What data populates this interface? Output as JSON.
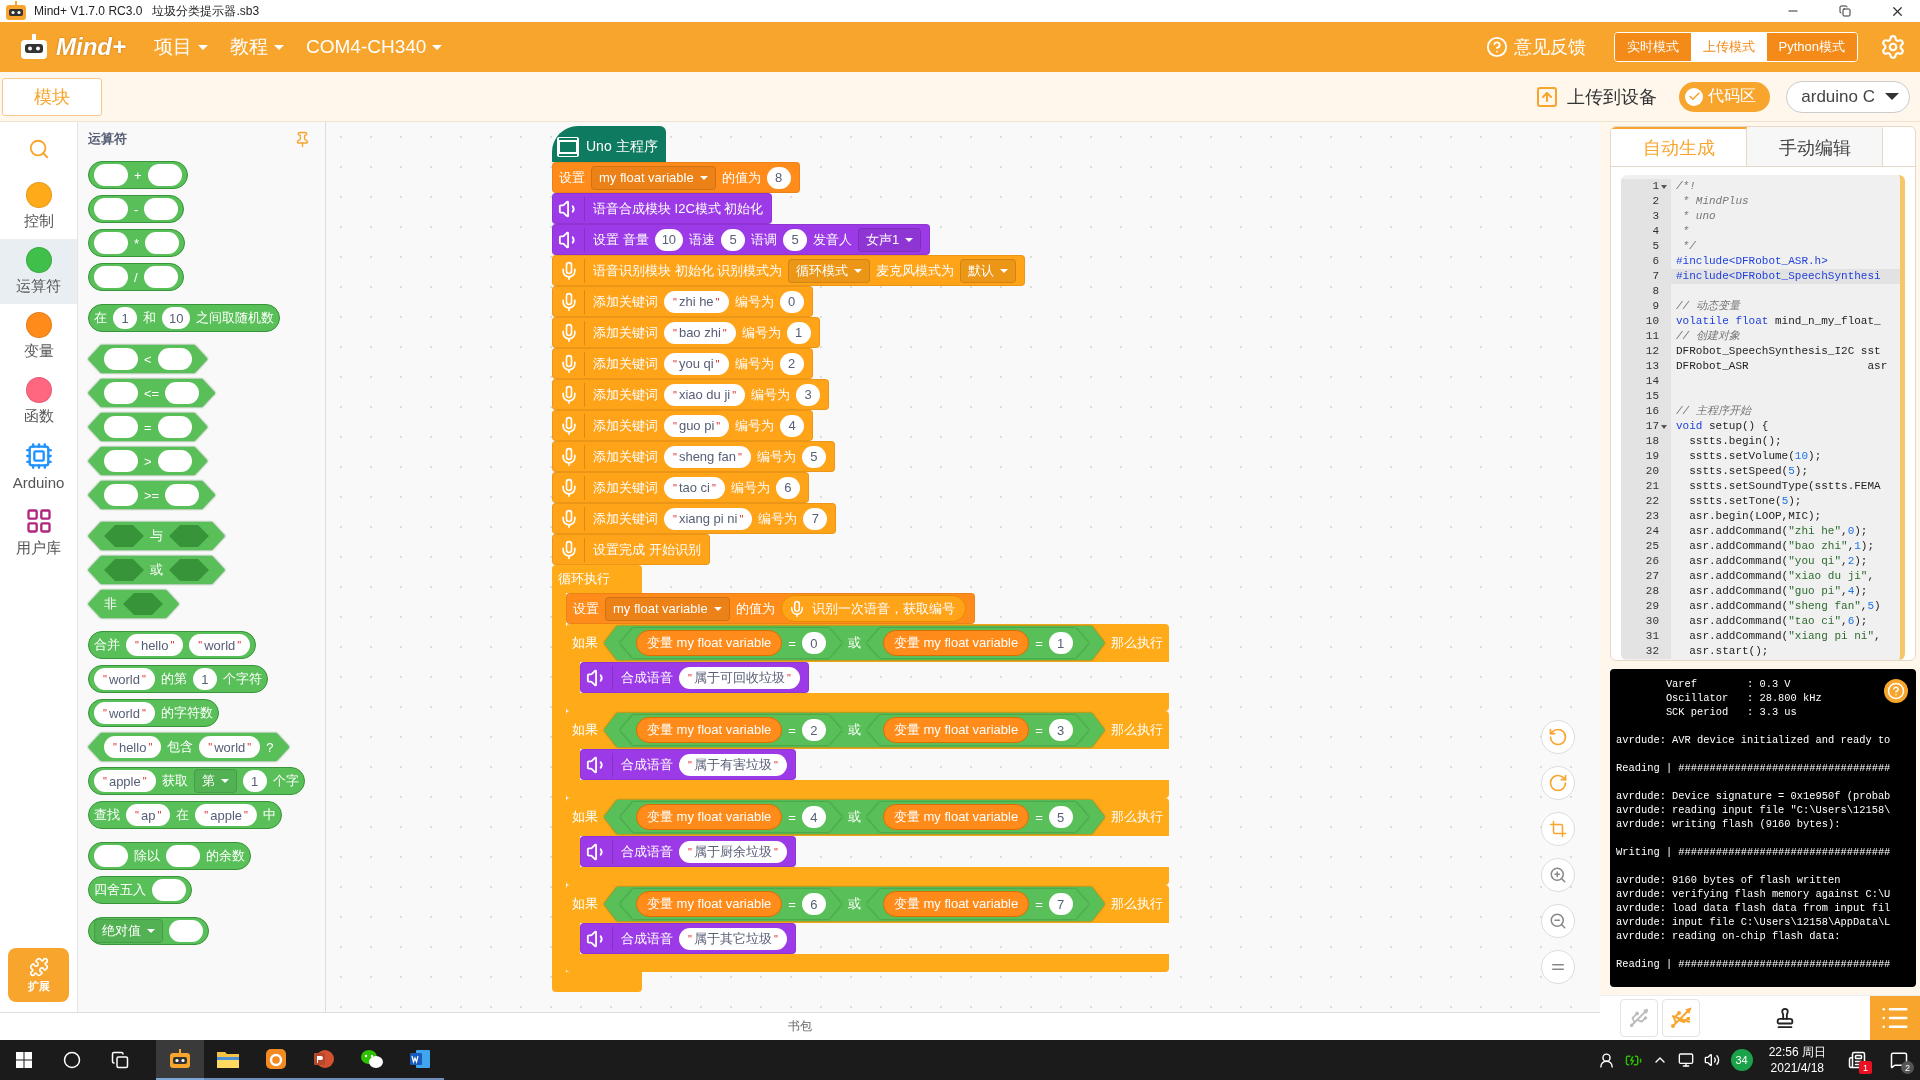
{
  "window": {
    "title": "Mind+ V1.7.0 RC3.0   垃圾分类提示器.sb3"
  },
  "menubar": {
    "logo": "Mind+",
    "menus": [
      {
        "label": "项目"
      },
      {
        "label": "教程"
      },
      {
        "label": "COM4-CH340"
      }
    ],
    "feedback": "意见反馈",
    "modes": [
      {
        "label": "实时模式",
        "selected": false
      },
      {
        "label": "上传模式",
        "selected": true
      },
      {
        "label": "Python模式",
        "selected": false
      }
    ]
  },
  "toolbar": {
    "tab": "模块",
    "upload": "上传到设备",
    "code_toggle": {
      "label": "代码区",
      "on": true
    },
    "language": "arduino C"
  },
  "categories": [
    {
      "kind": "dot",
      "label": "控制",
      "color": "#ffab19",
      "selected": false
    },
    {
      "kind": "dot",
      "label": "运算符",
      "color": "#40bf4a",
      "selected": true
    },
    {
      "kind": "dot",
      "label": "变量",
      "color": "#ff8c1a",
      "selected": false
    },
    {
      "kind": "dot",
      "label": "函数",
      "color": "#ff6680",
      "selected": false
    },
    {
      "kind": "chip",
      "label": "Arduino",
      "selected": false
    },
    {
      "kind": "library",
      "label": "用户库",
      "selected": false
    }
  ],
  "extension": "扩展",
  "palette": {
    "title": "运算符",
    "groups": [
      [
        {
          "kind": "reporter",
          "parts": [
            {
              "kind": "slot"
            },
            {
              "kind": "text",
              "text": "+"
            },
            {
              "kind": "slot"
            }
          ]
        },
        {
          "kind": "reporter",
          "parts": [
            {
              "kind": "slot"
            },
            {
              "kind": "text",
              "text": "-"
            },
            {
              "kind": "slot"
            }
          ]
        },
        {
          "kind": "reporter",
          "parts": [
            {
              "kind": "slot"
            },
            {
              "kind": "text",
              "text": "*"
            },
            {
              "kind": "slot"
            }
          ]
        },
        {
          "kind": "reporter",
          "parts": [
            {
              "kind": "slot"
            },
            {
              "kind": "text",
              "text": "/"
            },
            {
              "kind": "slot"
            }
          ]
        }
      ],
      [
        {
          "kind": "reporter",
          "parts": [
            {
              "kind": "text",
              "text": "在"
            },
            {
              "kind": "number",
              "text": "1"
            },
            {
              "kind": "text",
              "text": "和"
            },
            {
              "kind": "number",
              "text": "10"
            },
            {
              "kind": "text",
              "text": "之间取随机数"
            }
          ]
        }
      ],
      [
        {
          "kind": "boolean",
          "parts": [
            {
              "kind": "slot"
            },
            {
              "kind": "text",
              "text": "<"
            },
            {
              "kind": "slot"
            }
          ]
        },
        {
          "kind": "boolean",
          "parts": [
            {
              "kind": "slot"
            },
            {
              "kind": "text",
              "text": "<="
            },
            {
              "kind": "slot"
            }
          ]
        },
        {
          "kind": "boolean",
          "parts": [
            {
              "kind": "slot"
            },
            {
              "kind": "text",
              "text": "="
            },
            {
              "kind": "slot"
            }
          ]
        },
        {
          "kind": "boolean",
          "parts": [
            {
              "kind": "slot"
            },
            {
              "kind": "text",
              "text": ">"
            },
            {
              "kind": "slot"
            }
          ]
        },
        {
          "kind": "boolean",
          "parts": [
            {
              "kind": "slot"
            },
            {
              "kind": "text",
              "text": ">="
            },
            {
              "kind": "slot"
            }
          ]
        }
      ],
      [
        {
          "kind": "boolean",
          "parts": [
            {
              "kind": "bool-slot"
            },
            {
              "kind": "text",
              "text": "与"
            },
            {
              "kind": "bool-slot"
            }
          ]
        },
        {
          "kind": "boolean",
          "parts": [
            {
              "kind": "bool-slot"
            },
            {
              "kind": "text",
              "text": "或"
            },
            {
              "kind": "bool-slot"
            }
          ]
        },
        {
          "kind": "boolean",
          "parts": [
            {
              "kind": "text",
              "text": "非"
            },
            {
              "kind": "bool-slot"
            }
          ]
        }
      ],
      [
        {
          "kind": "reporter",
          "parts": [
            {
              "kind": "text",
              "text": "合并"
            },
            {
              "kind": "string",
              "quote": "\"",
              "text": "hello"
            },
            {
              "kind": "string",
              "quote": "\"",
              "text": "world"
            }
          ]
        },
        {
          "kind": "reporter",
          "parts": [
            {
              "kind": "string",
              "quote": "\"",
              "text": "world"
            },
            {
              "kind": "text",
              "text": "的第"
            },
            {
              "kind": "number",
              "text": "1"
            },
            {
              "kind": "text",
              "text": "个字符"
            }
          ]
        },
        {
          "kind": "reporter",
          "parts": [
            {
              "kind": "string",
              "quote": "\"",
              "text": "world"
            },
            {
              "kind": "text",
              "text": "的字符数"
            }
          ]
        },
        {
          "kind": "boolean",
          "parts": [
            {
              "kind": "string",
              "quote": "\"",
              "text": "hello"
            },
            {
              "kind": "text",
              "text": "包含"
            },
            {
              "kind": "string",
              "quote": "\"",
              "text": "world"
            },
            {
              "kind": "text",
              "text": "?"
            }
          ]
        },
        {
          "kind": "reporter",
          "parts": [
            {
              "kind": "string",
              "quote": "\"",
              "text": "apple"
            },
            {
              "kind": "text",
              "text": "获取"
            },
            {
              "kind": "dropdown",
              "text": "第"
            },
            {
              "kind": "number",
              "text": "1"
            },
            {
              "kind": "text",
              "text": "个字"
            }
          ]
        },
        {
          "kind": "reporter",
          "parts": [
            {
              "kind": "text",
              "text": "查找"
            },
            {
              "kind": "string",
              "quote": "\"",
              "text": "ap"
            },
            {
              "kind": "text",
              "text": "在"
            },
            {
              "kind": "string",
              "quote": "\"",
              "text": "apple"
            },
            {
              "kind": "text",
              "text": "中"
            }
          ]
        }
      ],
      [
        {
          "kind": "reporter",
          "parts": [
            {
              "kind": "slot"
            },
            {
              "kind": "text",
              "text": "除以"
            },
            {
              "kind": "slot"
            },
            {
              "kind": "text",
              "text": "的余数"
            }
          ]
        },
        {
          "kind": "reporter",
          "parts": [
            {
              "kind": "text",
              "text": "四舍五入"
            },
            {
              "kind": "slot"
            }
          ]
        }
      ],
      [
        {
          "kind": "reporter",
          "parts": [
            {
              "kind": "dropdown",
              "text": "绝对值"
            },
            {
              "kind": "slot"
            }
          ]
        }
      ]
    ]
  },
  "workspace": {
    "hat": "Uno 主程序",
    "blocks": [
      {
        "kind": "set",
        "parts": [
          {
            "kind": "text",
            "text": "设置"
          },
          {
            "kind": "dropdown",
            "text": "my float variable"
          },
          {
            "kind": "text",
            "text": "的值为"
          },
          {
            "kind": "number",
            "text": "8"
          }
        ]
      },
      {
        "kind": "speech",
        "parts": [
          {
            "kind": "text",
            "text": "语音合成模块 I2C模式 初始化"
          }
        ]
      },
      {
        "kind": "speech",
        "parts": [
          {
            "kind": "text",
            "text": "设置 音量"
          },
          {
            "kind": "number",
            "text": "10"
          },
          {
            "kind": "text",
            "text": "语速"
          },
          {
            "kind": "number",
            "text": "5"
          },
          {
            "kind": "text",
            "text": "语调"
          },
          {
            "kind": "number",
            "text": "5"
          },
          {
            "kind": "text",
            "text": "发音人"
          },
          {
            "kind": "dropdown",
            "text": "女声1"
          }
        ]
      },
      {
        "kind": "asr",
        "parts": [
          {
            "kind": "text",
            "text": "语音识别模块 初始化 识别模式为"
          },
          {
            "kind": "dropdown",
            "text": "循环模式"
          },
          {
            "kind": "text",
            "text": "麦克风模式为"
          },
          {
            "kind": "dropdown",
            "text": "默认"
          }
        ]
      },
      {
        "kind": "asr",
        "parts": [
          {
            "kind": "text",
            "text": "添加关键词"
          },
          {
            "kind": "string",
            "quote": "\"",
            "text": "zhi he"
          },
          {
            "kind": "text",
            "text": "编号为"
          },
          {
            "kind": "number",
            "text": "0"
          }
        ]
      },
      {
        "kind": "asr",
        "parts": [
          {
            "kind": "text",
            "text": "添加关键词"
          },
          {
            "kind": "string",
            "quote": "\"",
            "text": "bao zhi"
          },
          {
            "kind": "text",
            "text": "编号为"
          },
          {
            "kind": "number",
            "text": "1"
          }
        ]
      },
      {
        "kind": "asr",
        "parts": [
          {
            "kind": "text",
            "text": "添加关键词"
          },
          {
            "kind": "string",
            "quote": "\"",
            "text": "you qi"
          },
          {
            "kind": "text",
            "text": "编号为"
          },
          {
            "kind": "number",
            "text": "2"
          }
        ]
      },
      {
        "kind": "asr",
        "parts": [
          {
            "kind": "text",
            "text": "添加关键词"
          },
          {
            "kind": "string",
            "quote": "\"",
            "text": "xiao du ji"
          },
          {
            "kind": "text",
            "text": "编号为"
          },
          {
            "kind": "number",
            "text": "3"
          }
        ]
      },
      {
        "kind": "asr",
        "parts": [
          {
            "kind": "text",
            "text": "添加关键词"
          },
          {
            "kind": "string",
            "quote": "\"",
            "text": "guo pi"
          },
          {
            "kind": "text",
            "text": "编号为"
          },
          {
            "kind": "number",
            "text": "4"
          }
        ]
      },
      {
        "kind": "asr",
        "parts": [
          {
            "kind": "text",
            "text": "添加关键词"
          },
          {
            "kind": "string",
            "quote": "\"",
            "text": "sheng fan"
          },
          {
            "kind": "text",
            "text": "编号为"
          },
          {
            "kind": "number",
            "text": "5"
          }
        ]
      },
      {
        "kind": "asr",
        "parts": [
          {
            "kind": "text",
            "text": "添加关键词"
          },
          {
            "kind": "string",
            "quote": "\"",
            "text": "tao ci"
          },
          {
            "kind": "text",
            "text": "编号为"
          },
          {
            "kind": "number",
            "text": "6"
          }
        ]
      },
      {
        "kind": "asr",
        "parts": [
          {
            "kind": "text",
            "text": "添加关键词"
          },
          {
            "kind": "string",
            "quote": "\"",
            "text": "xiang pi ni"
          },
          {
            "kind": "text",
            "text": "编号为"
          },
          {
            "kind": "number",
            "text": "7"
          }
        ]
      },
      {
        "kind": "asr",
        "parts": [
          {
            "kind": "text",
            "text": "设置完成 开始识别"
          }
        ]
      },
      {
        "kind": "loop",
        "parts": [
          {
            "kind": "text",
            "text": "循环执行"
          }
        ],
        "children": [
          {
            "kind": "set",
            "parts": [
              {
                "kind": "text",
                "text": "设置"
              },
              {
                "kind": "dropdown",
                "text": "my float variable"
              },
              {
                "kind": "text",
                "text": "的值为"
              },
              {
                "kind": "asr-reporter",
                "text": "识别一次语音，获取编号"
              }
            ]
          },
          {
            "kind": "if",
            "parts": [
              {
                "kind": "text",
                "text": "如果"
              },
              {
                "kind": "boolean",
                "parts": [
                  {
                    "kind": "boolean",
                    "parts": [
                      {
                        "kind": "variable",
                        "text": "变量 my float variable"
                      },
                      {
                        "kind": "text",
                        "text": "="
                      },
                      {
                        "kind": "number",
                        "text": "0"
                      }
                    ]
                  },
                  {
                    "kind": "text",
                    "text": "或"
                  },
                  {
                    "kind": "boolean",
                    "parts": [
                      {
                        "kind": "variable",
                        "text": "变量 my float variable"
                      },
                      {
                        "kind": "text",
                        "text": "="
                      },
                      {
                        "kind": "number",
                        "text": "1"
                      }
                    ]
                  }
                ]
              },
              {
                "kind": "text",
                "text": "那么执行"
              }
            ],
            "children": [
              {
                "kind": "speech",
                "parts": [
                  {
                    "kind": "text",
                    "text": "合成语音"
                  },
                  {
                    "kind": "string",
                    "quote": "\"",
                    "text": "属于可回收垃圾"
                  }
                ]
              }
            ]
          },
          {
            "kind": "if",
            "parts": [
              {
                "kind": "text",
                "text": "如果"
              },
              {
                "kind": "boolean",
                "parts": [
                  {
                    "kind": "boolean",
                    "parts": [
                      {
                        "kind": "variable",
                        "text": "变量 my float variable"
                      },
                      {
                        "kind": "text",
                        "text": "="
                      },
                      {
                        "kind": "number",
                        "text": "2"
                      }
                    ]
                  },
                  {
                    "kind": "text",
                    "text": "或"
                  },
                  {
                    "kind": "boolean",
                    "parts": [
                      {
                        "kind": "variable",
                        "text": "变量 my float variable"
                      },
                      {
                        "kind": "text",
                        "text": "="
                      },
                      {
                        "kind": "number",
                        "text": "3"
                      }
                    ]
                  }
                ]
              },
              {
                "kind": "text",
                "text": "那么执行"
              }
            ],
            "children": [
              {
                "kind": "speech",
                "parts": [
                  {
                    "kind": "text",
                    "text": "合成语音"
                  },
                  {
                    "kind": "string",
                    "quote": "\"",
                    "text": "属于有害垃圾"
                  }
                ]
              }
            ]
          },
          {
            "kind": "if",
            "parts": [
              {
                "kind": "text",
                "text": "如果"
              },
              {
                "kind": "boolean",
                "parts": [
                  {
                    "kind": "boolean",
                    "parts": [
                      {
                        "kind": "variable",
                        "text": "变量 my float variable"
                      },
                      {
                        "kind": "text",
                        "text": "="
                      },
                      {
                        "kind": "number",
                        "text": "4"
                      }
                    ]
                  },
                  {
                    "kind": "text",
                    "text": "或"
                  },
                  {
                    "kind": "boolean",
                    "parts": [
                      {
                        "kind": "variable",
                        "text": "变量 my float variable"
                      },
                      {
                        "kind": "text",
                        "text": "="
                      },
                      {
                        "kind": "number",
                        "text": "5"
                      }
                    ]
                  }
                ]
              },
              {
                "kind": "text",
                "text": "那么执行"
              }
            ],
            "children": [
              {
                "kind": "speech",
                "parts": [
                  {
                    "kind": "text",
                    "text": "合成语音"
                  },
                  {
                    "kind": "string",
                    "quote": "\"",
                    "text": "属于厨余垃圾"
                  }
                ]
              }
            ]
          },
          {
            "kind": "if",
            "parts": [
              {
                "kind": "text",
                "text": "如果"
              },
              {
                "kind": "boolean",
                "parts": [
                  {
                    "kind": "boolean",
                    "parts": [
                      {
                        "kind": "variable",
                        "text": "变量 my float variable"
                      },
                      {
                        "kind": "text",
                        "text": "="
                      },
                      {
                        "kind": "number",
                        "text": "6"
                      }
                    ]
                  },
                  {
                    "kind": "text",
                    "text": "或"
                  },
                  {
                    "kind": "boolean",
                    "parts": [
                      {
                        "kind": "variable",
                        "text": "变量 my float variable"
                      },
                      {
                        "kind": "text",
                        "text": "="
                      },
                      {
                        "kind": "number",
                        "text": "7"
                      }
                    ]
                  }
                ]
              },
              {
                "kind": "text",
                "text": "那么执行"
              }
            ],
            "children": [
              {
                "kind": "speech",
                "parts": [
                  {
                    "kind": "text",
                    "text": "合成语音"
                  },
                  {
                    "kind": "string",
                    "quote": "\"",
                    "text": "属于其它垃圾"
                  }
                ]
              }
            ]
          }
        ]
      }
    ]
  },
  "backpack": "书包",
  "code_panel": {
    "tabs": [
      {
        "label": "自动生成",
        "selected": true
      },
      {
        "label": "手动编辑",
        "selected": false
      }
    ],
    "lines": [
      {
        "n": "1",
        "fold": true,
        "segs": [
          {
            "kind": "comment",
            "text": "/*!"
          }
        ]
      },
      {
        "n": "2",
        "segs": [
          {
            "kind": "comment",
            "text": " * MindPlus"
          }
        ]
      },
      {
        "n": "3",
        "segs": [
          {
            "kind": "comment",
            "text": " * uno"
          }
        ]
      },
      {
        "n": "4",
        "segs": [
          {
            "kind": "comment",
            "text": " *"
          }
        ]
      },
      {
        "n": "5",
        "segs": [
          {
            "kind": "comment",
            "text": " */"
          }
        ]
      },
      {
        "n": "6",
        "segs": [
          {
            "kind": "include",
            "text": "#include<DFRobot_ASR.h>"
          }
        ]
      },
      {
        "n": "7",
        "current": true,
        "segs": [
          {
            "kind": "include",
            "text": "#include<DFRobot_SpeechSynthesi"
          }
        ]
      },
      {
        "n": "8"
      },
      {
        "n": "9",
        "segs": [
          {
            "kind": "comment",
            "text": "// 动态变量"
          }
        ]
      },
      {
        "n": "10",
        "segs": [
          {
            "kind": "keyword",
            "text": "volatile float"
          },
          {
            "kind": "plain",
            "text": " mind_n_my_float_"
          }
        ]
      },
      {
        "n": "11",
        "segs": [
          {
            "kind": "comment",
            "text": "// 创建对象"
          }
        ]
      },
      {
        "n": "12",
        "segs": [
          {
            "kind": "plain",
            "text": "DFRobot_SpeechSynthesis_I2C sst"
          }
        ]
      },
      {
        "n": "13",
        "segs": [
          {
            "kind": "plain",
            "text": "DFRobot_ASR                  asr"
          }
        ]
      },
      {
        "n": "14"
      },
      {
        "n": "15"
      },
      {
        "n": "16",
        "segs": [
          {
            "kind": "comment",
            "text": "// 主程序开始"
          }
        ]
      },
      {
        "n": "17",
        "fold": true,
        "segs": [
          {
            "kind": "keyword",
            "text": "void"
          },
          {
            "kind": "plain",
            "text": " setup() {"
          }
        ]
      },
      {
        "n": "18",
        "segs": [
          {
            "kind": "plain",
            "text": "  sstts.begin();"
          }
        ]
      },
      {
        "n": "19",
        "segs": [
          {
            "kind": "plain",
            "text": "  sstts.setVolume("
          },
          {
            "kind": "num",
            "text": "10"
          },
          {
            "kind": "plain",
            "text": ");"
          }
        ]
      },
      {
        "n": "20",
        "segs": [
          {
            "kind": "plain",
            "text": "  sstts.setSpeed("
          },
          {
            "kind": "num",
            "text": "5"
          },
          {
            "kind": "plain",
            "text": ");"
          }
        ]
      },
      {
        "n": "21",
        "segs": [
          {
            "kind": "plain",
            "text": "  sstts.setSoundType(sstts.FEMA"
          }
        ]
      },
      {
        "n": "22",
        "segs": [
          {
            "kind": "plain",
            "text": "  sstts.setTone("
          },
          {
            "kind": "num",
            "text": "5"
          },
          {
            "kind": "plain",
            "text": ");"
          }
        ]
      },
      {
        "n": "23",
        "segs": [
          {
            "kind": "plain",
            "text": "  asr.begin(LOOP,MIC);"
          }
        ]
      },
      {
        "n": "24",
        "segs": [
          {
            "kind": "plain",
            "text": "  asr.addCommand("
          },
          {
            "kind": "str",
            "text": "\"zhi he\""
          },
          {
            "kind": "plain",
            "text": ","
          },
          {
            "kind": "num",
            "text": "0"
          },
          {
            "kind": "plain",
            "text": ");"
          }
        ]
      },
      {
        "n": "25",
        "segs": [
          {
            "kind": "plain",
            "text": "  asr.addCommand("
          },
          {
            "kind": "str",
            "text": "\"bao zhi\""
          },
          {
            "kind": "plain",
            "text": ","
          },
          {
            "kind": "num",
            "text": "1"
          },
          {
            "kind": "plain",
            "text": ");"
          }
        ]
      },
      {
        "n": "26",
        "segs": [
          {
            "kind": "plain",
            "text": "  asr.addCommand("
          },
          {
            "kind": "str",
            "text": "\"you qi\""
          },
          {
            "kind": "plain",
            "text": ","
          },
          {
            "kind": "num",
            "text": "2"
          },
          {
            "kind": "plain",
            "text": ");"
          }
        ]
      },
      {
        "n": "27",
        "segs": [
          {
            "kind": "plain",
            "text": "  asr.addCommand("
          },
          {
            "kind": "str",
            "text": "\"xiao du ji\""
          },
          {
            "kind": "plain",
            "text": ","
          }
        ]
      },
      {
        "n": "28",
        "segs": [
          {
            "kind": "plain",
            "text": "  asr.addCommand("
          },
          {
            "kind": "str",
            "text": "\"guo pi\""
          },
          {
            "kind": "plain",
            "text": ","
          },
          {
            "kind": "num",
            "text": "4"
          },
          {
            "kind": "plain",
            "text": ");"
          }
        ]
      },
      {
        "n": "29",
        "segs": [
          {
            "kind": "plain",
            "text": "  asr.addCommand("
          },
          {
            "kind": "str",
            "text": "\"sheng fan\""
          },
          {
            "kind": "plain",
            "text": ","
          },
          {
            "kind": "num",
            "text": "5"
          },
          {
            "kind": "plain",
            "text": ")"
          }
        ]
      },
      {
        "n": "30",
        "segs": [
          {
            "kind": "plain",
            "text": "  asr.addCommand("
          },
          {
            "kind": "str",
            "text": "\"tao ci\""
          },
          {
            "kind": "plain",
            "text": ","
          },
          {
            "kind": "num",
            "text": "6"
          },
          {
            "kind": "plain",
            "text": ");"
          }
        ]
      },
      {
        "n": "31",
        "segs": [
          {
            "kind": "plain",
            "text": "  asr.addCommand("
          },
          {
            "kind": "str",
            "text": "\"xiang pi ni\""
          },
          {
            "kind": "plain",
            "text": ","
          }
        ]
      },
      {
        "n": "32",
        "segs": [
          {
            "kind": "plain",
            "text": "  asr.start();"
          }
        ]
      }
    ]
  },
  "console": {
    "lines": [
      {
        "text": "        Varef        : 0.3 V"
      },
      {
        "text": "        Oscillator   : 28.800 kHz"
      },
      {
        "text": "        SCK period   : 3.3 us"
      },
      {
        "text": "avrdude: AVR device initialized and ready to",
        "space_before": true
      },
      {
        "text": "Reading | ##################################",
        "space_before": true
      },
      {
        "text": "avrdude: Device signature = 0x1e950f (probab",
        "space_before": true
      },
      {
        "text": "avrdude: reading input file \"C:\\Users\\12158\\"
      },
      {
        "text": "avrdude: writing flash (9160 bytes):"
      },
      {
        "text": "Writing | ##################################",
        "space_before": true
      },
      {
        "text": "avrdude: 9160 bytes of flash written",
        "space_before": true
      },
      {
        "text": "avrdude: verifying flash memory against C:\\U"
      },
      {
        "text": "avrdude: load data flash data from input fil"
      },
      {
        "text": "avrdude: input file C:\\Users\\12158\\AppData\\L"
      },
      {
        "text": "avrdude: reading on-chip flash data:"
      },
      {
        "text": "Reading | ##################################",
        "space_before": true
      }
    ]
  },
  "device_bar": {
    "connections": [
      {
        "kind": "usb",
        "selected": false
      },
      {
        "kind": "usb-off",
        "selected": true
      }
    ]
  },
  "taskbar": {
    "apps": [
      {
        "kind": "robot",
        "active": true
      },
      {
        "kind": "folder",
        "active": false
      },
      {
        "kind": "browser",
        "active": false
      },
      {
        "kind": "slides",
        "active": false
      },
      {
        "kind": "chat",
        "active": false
      },
      {
        "kind": "document",
        "active": false
      }
    ],
    "badge": "34",
    "time": "22:56 周日",
    "date": "2021/4/18",
    "notifications": "1",
    "messages": "2"
  }
}
